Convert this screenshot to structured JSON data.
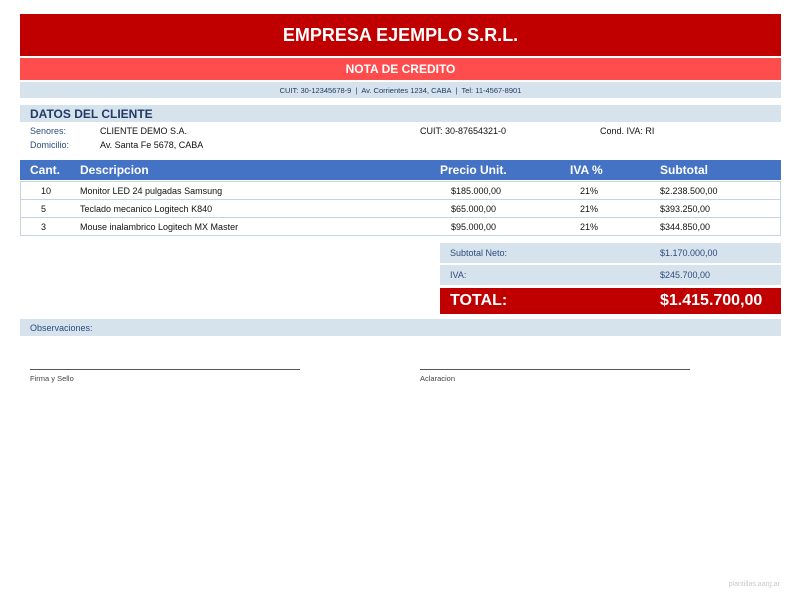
{
  "header": {
    "company_name": "EMPRESA EJEMPLO S.R.L.",
    "document_type": "NOTA DE CREDITO",
    "info": {
      "cuit": "CUIT: 30-12345678-9",
      "address": "Av. Corrientes 1234, CABA",
      "phone": "Tel: 11-4567-8901",
      "separator": "|"
    }
  },
  "client": {
    "section_title": "DATOS DEL CLIENTE",
    "name_label": "Senores:",
    "name_value": "CLIENTE DEMO S.A.",
    "cuit_text": "CUIT: 30-87654321-0",
    "iva_condition_text": "Cond. IVA: RI",
    "address_label": "Domicilio:",
    "address_value": "Av. Santa Fe 5678, CABA"
  },
  "items_table": {
    "headers": {
      "qty": "Cant.",
      "description": "Descripcion",
      "unit_price": "Precio Unit.",
      "iva": "IVA %",
      "subtotal": "Subtotal"
    },
    "rows": [
      {
        "qty": "10",
        "description": "Monitor LED 24 pulgadas Samsung",
        "unit_price": "$185.000,00",
        "iva": "21%",
        "subtotal": "$2.238.500,00"
      },
      {
        "qty": "5",
        "description": "Teclado mecanico Logitech K840",
        "unit_price": "$65.000,00",
        "iva": "21%",
        "subtotal": "$393.250,00"
      },
      {
        "qty": "3",
        "description": "Mouse inalambrico Logitech MX Master",
        "unit_price": "$95.000,00",
        "iva": "21%",
        "subtotal": "$344.850,00"
      }
    ]
  },
  "totals": {
    "net_label": "Subtotal Neto:",
    "net_value": "$1.170.000,00",
    "iva_label": "IVA:",
    "iva_value": "$245.700,00",
    "total_label": "TOTAL:",
    "total_value": "$1.415.700,00"
  },
  "observations": {
    "label": "Observaciones:"
  },
  "signatures": {
    "left_label": "Firma y Sello",
    "right_label": "Aclaracion"
  },
  "footer": {
    "watermark": "plantillas.aarg.ar"
  },
  "colors": {
    "primary_red": "#c00000",
    "secondary_red": "#ff4d4d",
    "table_header_blue": "#4472c4",
    "light_blue_band": "#d6e2ec",
    "label_blue": "#2b4c7e"
  }
}
